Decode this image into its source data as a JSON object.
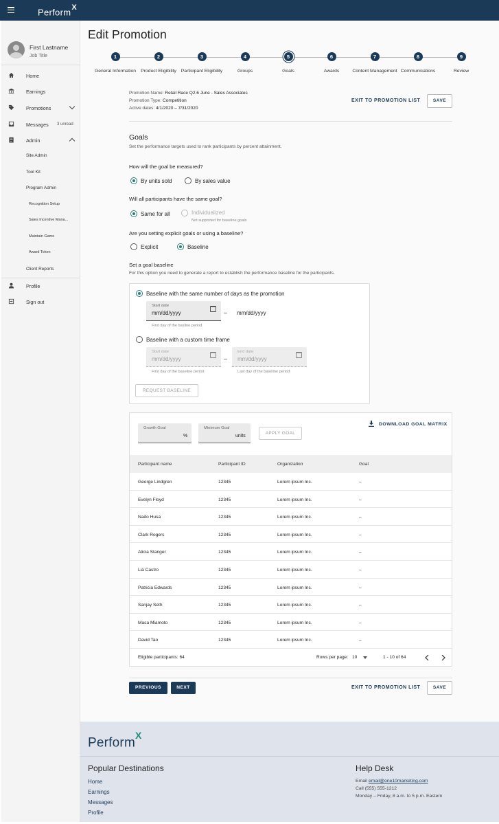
{
  "app": {
    "logo": "Perform",
    "logo_mark": "X"
  },
  "user": {
    "name": "First Lastname",
    "job_title": "Job Title"
  },
  "nav": {
    "home": "Home",
    "earnings": "Earnings",
    "promotions": "Promotions",
    "messages": "Messages",
    "messages_badge": "3 unread",
    "admin": "Admin",
    "site_admin": "Site Admin",
    "tool_kit": "Tool Kit",
    "program_admin": "Program Admin",
    "recognition_setup": "Recognition Setup",
    "sales_incentive": "Sales Incentive Mana...",
    "maintain_game": "Maintain Game",
    "award_token": "Award Token",
    "client_reports": "Client Reports",
    "profile": "Profile",
    "sign_out": "Sign out"
  },
  "page": {
    "title": "Edit Promotion"
  },
  "steps": [
    {
      "num": "1",
      "label": "General Information"
    },
    {
      "num": "2",
      "label": "Product Eligibility"
    },
    {
      "num": "3",
      "label": "Participant Eligibility"
    },
    {
      "num": "4",
      "label": "Groups"
    },
    {
      "num": "5",
      "label": "Goals"
    },
    {
      "num": "6",
      "label": "Awards"
    },
    {
      "num": "7",
      "label": "Content Management"
    },
    {
      "num": "8",
      "label": "Communications"
    },
    {
      "num": "9",
      "label": "Review"
    }
  ],
  "promotion": {
    "name_label": "Promotion Name:",
    "name": "Retail Race Q2.6 June - Sales Associates",
    "type_label": "Promotion Type:",
    "type": "Competition",
    "dates_label": "Active dates:",
    "dates": "4/1/2020 – 7/31/2020"
  },
  "actions": {
    "exit": "EXIT TO PROMOTION LIST",
    "save": "SAVE",
    "previous": "PREVIOUS",
    "next": "NEXT"
  },
  "goals": {
    "heading": "Goals",
    "description": "Set the performance targets used to rank participants by percent attainment.",
    "q1": "How will the goal be measured?",
    "q1_opt1": "By units sold",
    "q1_opt2": "By sales value",
    "q2": "Will all participants have the same goal?",
    "q2_opt1": "Same for all",
    "q2_opt2": "Individualized",
    "q2_note": "Not supported for baseline goals",
    "q3": "Are you setting explicit goals or using a baseline?",
    "q3_opt1": "Explicit",
    "q3_opt2": "Baseline",
    "baseline_heading": "Set a goal baseline",
    "baseline_desc": "For this option you need to generate a report to establish the performance baseline for the participants.",
    "opt_same_days": "Baseline with the same number of days as the promotion",
    "start_date_label": "Start date",
    "date_placeholder": "mm/dd/yyyy",
    "start_hint": "First day of the basline period",
    "end_plain": "mm/dd/yyyy",
    "opt_custom": "Baseline with a custom time frame",
    "end_date_label": "End date",
    "start_hint2": "First day of the baseline period",
    "end_hint": "Last day of the baseline period",
    "request_btn": "REQUEST BASELINE",
    "dash": "–"
  },
  "matrix": {
    "growth_label": "Growth Goal",
    "growth_suffix": "%",
    "min_label": "Minimum Goal",
    "min_suffix": "units",
    "apply": "APPLY GOAL",
    "download": "DOWNLOAD GOAL MATRIX",
    "columns": [
      "Participant name",
      "Participant ID",
      "Organization",
      "Goal"
    ],
    "rows": [
      [
        "George Lindgren",
        "12345",
        "Lorem ipsum Inc.",
        "–"
      ],
      [
        "Evelyn Floyd",
        "12345",
        "Lorem ipsum Inc.",
        "–"
      ],
      [
        "Nado Husa",
        "12345",
        "Lorem ipsum Inc.",
        "–"
      ],
      [
        "Clark Rogers",
        "12345",
        "Lorem ipsum Inc.",
        "–"
      ],
      [
        "Alicia Stanger",
        "12345",
        "Lorem ipsum Inc.",
        "–"
      ],
      [
        "Lia Castro",
        "12345",
        "Lorem ipsum Inc.",
        "–"
      ],
      [
        "Patricia Edwards",
        "12345",
        "Lorem ipsum Inc.",
        "–"
      ],
      [
        "Sanjay Seth",
        "12345",
        "Lorem ipsum Inc.",
        "–"
      ],
      [
        "Masa Miamoto",
        "12345",
        "Lorem ipsum Inc.",
        "–"
      ],
      [
        "David Tao",
        "12345",
        "Lorem ipsum Inc.",
        "–"
      ]
    ],
    "eligible": "Eligible participants: 64",
    "rows_per_page_label": "Rows per page:",
    "rows_per_page": "10",
    "range": "1 - 10 of 64"
  },
  "footer": {
    "logo": "Perform",
    "logo_mark": "X",
    "popular": "Popular Destinations",
    "links": [
      "Home",
      "Earnings",
      "Messages",
      "Profile"
    ],
    "help": "Help Desk",
    "email_label": "Email",
    "email": "email@one10marketing.com",
    "call": "Call (555) 555-1212",
    "hours": "Monday – Friday, 8 a.m. to 5 p.m. Eastern"
  },
  "colors": {
    "primary": "#1b3a57",
    "accent": "#2a7d78",
    "footer_bg": "#dfe4ec"
  }
}
